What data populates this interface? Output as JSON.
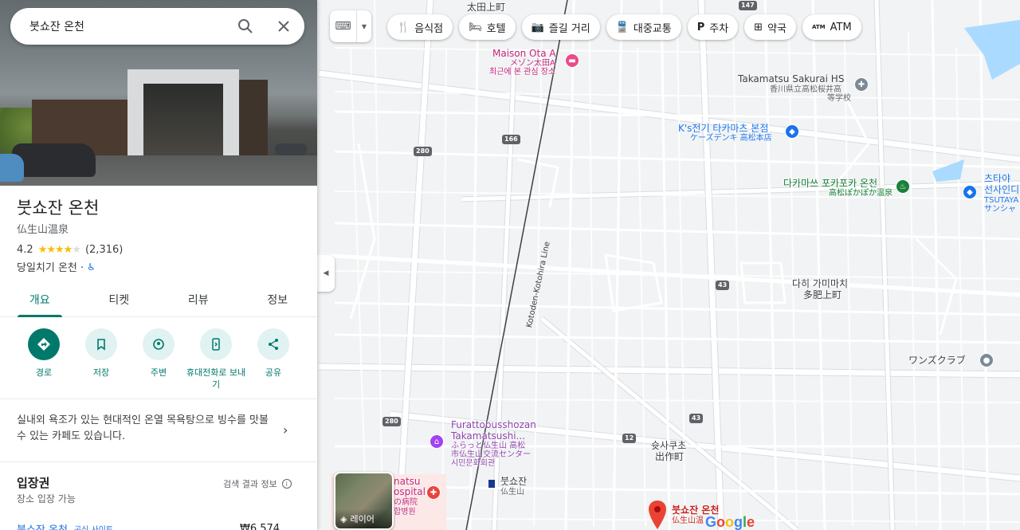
{
  "search": {
    "value": "붓쇼잔 온천"
  },
  "place": {
    "title": "붓쇼잔 온천",
    "subtitle": "仏生山温泉",
    "rating": "4.2",
    "stars": "★★★★",
    "star_off": "★",
    "reviews": "(2,316)",
    "category": "당일치기 온천 ·"
  },
  "tabs": [
    {
      "label": "개요"
    },
    {
      "label": "티켓"
    },
    {
      "label": "리뷰"
    },
    {
      "label": "정보"
    }
  ],
  "actions": [
    {
      "label": "경로"
    },
    {
      "label": "저장"
    },
    {
      "label": "주변"
    },
    {
      "label": "휴대전화로 보내기"
    },
    {
      "label": "공유"
    }
  ],
  "description": "실내외 욕조가 있는 현대적인 온열 목욕탕으로 빙수를 맛볼 수 있는 카페도 있습니다.",
  "tickets": {
    "title": "입장권",
    "subtitle": "장소 입장 가능",
    "source": "검색 결과 정보",
    "row_name": "붓쇼잔 온천",
    "row_badge": "공식 사이트",
    "row_price": "₩6,574"
  },
  "map": {
    "keyboard_icon": "keyboard-icon",
    "chips": [
      {
        "icon": "restaurant-icon",
        "label": "음식점"
      },
      {
        "icon": "hotel-icon",
        "label": "호텔"
      },
      {
        "icon": "camera-icon",
        "label": "즐길 거리"
      },
      {
        "icon": "transit-icon",
        "label": "대중교통"
      },
      {
        "icon": "parking-icon",
        "label": "주차"
      },
      {
        "icon": "pharmacy-icon",
        "label": "약국"
      },
      {
        "icon": "atm-icon",
        "label": "ATM"
      }
    ],
    "layers_label": "레이어",
    "labels": {
      "ota_town": "太田上町",
      "maison_ota": "Maison Ota A",
      "maison_ota_jp": "メゾン太田A",
      "maison_ota_note": "최근에 본 관심 장소",
      "sakurai_hs": "Takamatsu Sakurai HS",
      "sakurai_hs_jp1": "香川県立高松桜井高",
      "sakurai_hs_jp2": "等学校",
      "ks_denki": "K's전기 타카마츠 본점",
      "ks_denki_jp": "ケーズデンキ 高松本店",
      "pokapoka": "다카마쓰 포카포카 온천",
      "pokapoka_jp": "高松ぽかぽか温泉",
      "tsutaya1": "츠타야",
      "tsutaya2": "선사인디",
      "tsutaya_jp1": "TSUTAYA",
      "tsutaya_jp2": "サンシャ",
      "tahi1": "다히 가미마치",
      "tahi2": "多肥上町",
      "wanzu": "ワンズクラブ",
      "furatto1": "Furattobusshozan",
      "furatto2": "Takamatsushi...",
      "furatto_jp1": "ふらっと仏生山 高松",
      "furatto_jp2": "市仏生山交流センター",
      "furatto_jp3": "시민문화회관",
      "hospital1": "natsu",
      "hospital2": "ospital",
      "hospital_jp1": "の病院",
      "hospital_jp2": "합병원",
      "station1": "붓쇼잔",
      "station2": "仏生山",
      "shussaku1": "슛사쿠초",
      "shussaku2": "出作町",
      "rail": "Kotoden-Kotohira Line",
      "pin1": "붓쇼잔 온천",
      "pin2": "仏生山温"
    },
    "shields": [
      "147",
      "280",
      "166",
      "43",
      "43",
      "12",
      "280",
      "43"
    ],
    "google": "Google"
  }
}
